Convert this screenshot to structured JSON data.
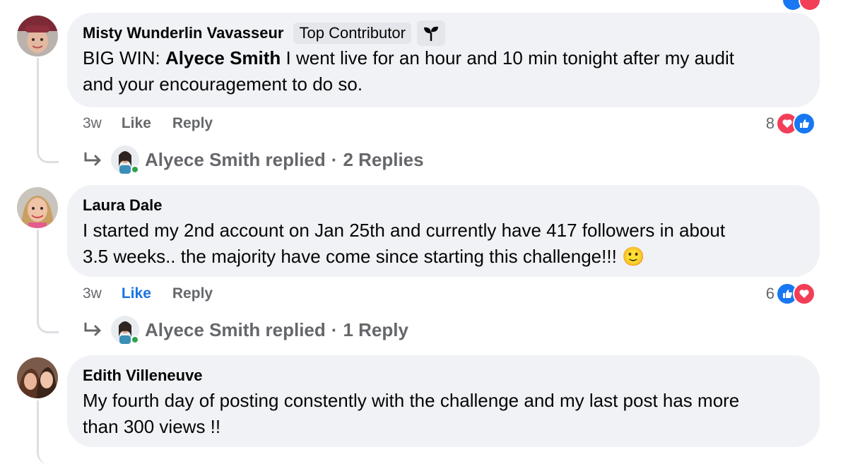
{
  "comments": [
    {
      "author": "Misty Wunderlin Vavasseur",
      "badge": "Top Contributor",
      "text_prefix": "BIG WIN: ",
      "mention": "Alyece Smith",
      "text_line1_rest": " I went live for an hour and 10 min tonight after my audit",
      "text_line2": "and your encouragement to do so.",
      "time": "3w",
      "like_label": "Like",
      "reply_label": "Reply",
      "reaction_count": "8",
      "reactions": [
        "love",
        "like"
      ],
      "replied_text": "Alyece Smith replied",
      "replies_text": "2 Replies",
      "like_active": false
    },
    {
      "author": "Laura Dale",
      "text_line1": "I started my 2nd account on Jan 25th and currently have 417 followers in about",
      "text_line2": "3.5 weeks.. the majority have come since starting this challenge!!! ",
      "emoji": "🙂",
      "time": "3w",
      "like_label": "Like",
      "reply_label": "Reply",
      "reaction_count": "6",
      "reactions": [
        "like",
        "love"
      ],
      "replied_text": "Alyece Smith replied",
      "replies_text": "1 Reply",
      "like_active": true
    },
    {
      "author": "Edith Villeneuve",
      "text_line1": "My fourth day of posting constently with the challenge and my last post has more",
      "text_line2": "than 300 views !!"
    }
  ],
  "colors": {
    "bubble": "#f0f2f5",
    "accent_blue": "#1b74e4",
    "like_blue": "#1877f2",
    "love_red": "#f33e58",
    "secondary_text": "#65676b"
  }
}
